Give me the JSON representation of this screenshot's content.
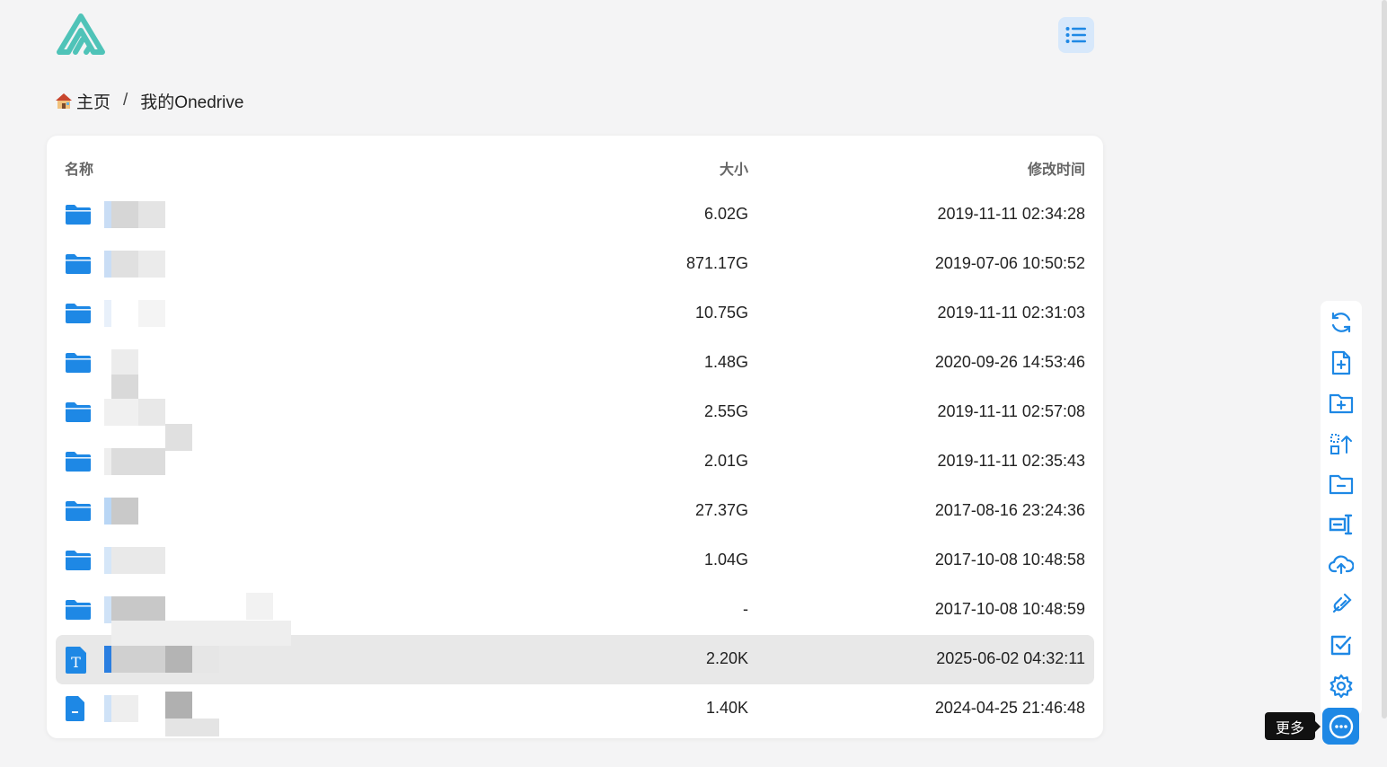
{
  "breadcrumb": {
    "home_icon": "house-emoji",
    "home_label": "主页",
    "separator": "/",
    "current": "我的Onedrive"
  },
  "table": {
    "headers": {
      "name": "名称",
      "size": "大小",
      "modified": "修改时间"
    },
    "rows": [
      {
        "type": "folder",
        "size": "6.02G",
        "modified": "2019-11-11 02:34:28"
      },
      {
        "type": "folder",
        "size": "871.17G",
        "modified": "2019-07-06 10:50:52"
      },
      {
        "type": "folder",
        "size": "10.75G",
        "modified": "2019-11-11 02:31:03"
      },
      {
        "type": "folder",
        "size": "1.48G",
        "modified": "2020-09-26 14:53:46"
      },
      {
        "type": "folder",
        "size": "2.55G",
        "modified": "2019-11-11 02:57:08"
      },
      {
        "type": "folder",
        "size": "2.01G",
        "modified": "2019-11-11 02:35:43"
      },
      {
        "type": "folder",
        "size": "27.37G",
        "modified": "2017-08-16 23:24:36"
      },
      {
        "type": "folder",
        "size": "1.04G",
        "modified": "2017-10-08 10:48:58"
      },
      {
        "type": "folder",
        "size": "-",
        "modified": "2017-10-08 10:48:59"
      },
      {
        "type": "text-file",
        "size": "2.20K",
        "modified": "2025-06-02 04:32:11",
        "highlighted": true
      },
      {
        "type": "file",
        "size": "1.40K",
        "modified": "2024-04-25 21:46:48"
      }
    ]
  },
  "sidebar": {
    "tools": [
      "refresh-icon",
      "new-file-icon",
      "new-folder-icon",
      "batch-rename-icon",
      "remove-folder-icon",
      "rename-icon",
      "upload-cloud-icon",
      "link-icon",
      "select-check-icon",
      "settings-icon"
    ],
    "more_tooltip": "更多",
    "more_icon": "more-dots-icon"
  },
  "colors": {
    "accent": "#1e88e5",
    "folder": "#1e88e5",
    "logo_teal": "#4fc3b8",
    "highlight_row": "#e8e8e8"
  }
}
